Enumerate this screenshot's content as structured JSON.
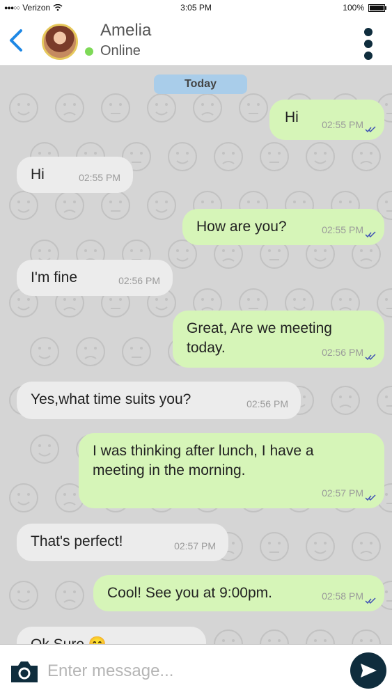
{
  "status_bar": {
    "carrier": "Verizon",
    "time": "3:05 PM",
    "battery": "100%"
  },
  "header": {
    "contact_name": "Amelia",
    "presence": "Online"
  },
  "chat": {
    "day_label": "Today",
    "messages": [
      {
        "direction": "out",
        "text": "Hi",
        "time": "02:55 PM",
        "read": true
      },
      {
        "direction": "in",
        "text": "Hi",
        "time": "02:55 PM"
      },
      {
        "direction": "out",
        "text": "How are you?",
        "time": "02:55 PM",
        "read": true
      },
      {
        "direction": "in",
        "text": "I'm fine",
        "time": "02:56 PM"
      },
      {
        "direction": "out",
        "text": "Great, Are we meeting today.",
        "time": "02:56 PM",
        "read": true
      },
      {
        "direction": "in",
        "text": "Yes,what time suits you?",
        "time": "02:56 PM"
      },
      {
        "direction": "out",
        "text": "I was thinking after lunch, I have a meeting in the morning.",
        "time": "02:57 PM",
        "read": true
      },
      {
        "direction": "in",
        "text": "That's perfect!",
        "time": "02:57 PM"
      },
      {
        "direction": "out",
        "text": "Cool! See you at 9:00pm.",
        "time": "02:58 PM",
        "read": true
      },
      {
        "direction": "in",
        "text": "Ok Sure 😊",
        "time": ""
      }
    ]
  },
  "composer": {
    "placeholder": "Enter message..."
  },
  "colors": {
    "incoming_bubble": "#ececec",
    "outgoing_bubble": "#d6f5b8",
    "accent_dark": "#0f2d3d",
    "back_arrow": "#1e88e5",
    "online": "#7ed957",
    "day_pill": "#a9cdea",
    "read_check": "#3f51b5"
  },
  "icons": {
    "back": "chevron-left-icon",
    "menu": "kebab-menu-icon",
    "camera": "camera-icon",
    "send": "send-icon",
    "read": "double-check-icon"
  }
}
